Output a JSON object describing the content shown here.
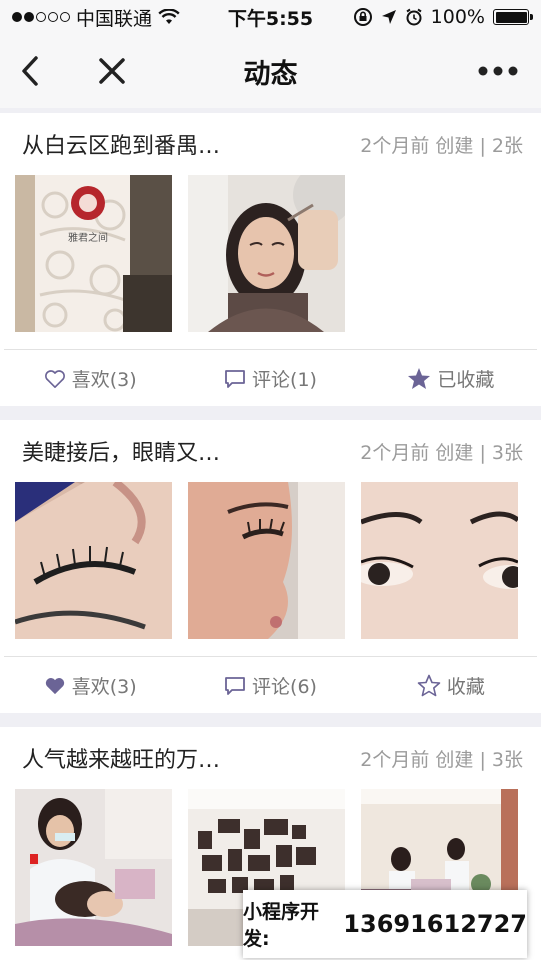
{
  "status_bar": {
    "carrier": "中国联通",
    "time": "下午5:55",
    "battery": "100%"
  },
  "nav": {
    "title": "动态",
    "back_icon": "chevron-left-icon",
    "close_icon": "close-icon",
    "more_icon": "more-dots-icon"
  },
  "colors": {
    "accent": "#6b6496",
    "meta_text": "#9b9b9b",
    "action_text": "#777777"
  },
  "posts": [
    {
      "title": "从白云区跑到番禺…",
      "meta": "2个月前 创建 | 2张",
      "photos": [
        "salon-entrance-photo",
        "brow-treatment-photo"
      ],
      "like_label": "喜欢(3)",
      "like_active": false,
      "comment_label": "评论(1)",
      "favorite_label": "已收藏",
      "favorite_active": true
    },
    {
      "title": "美睫接后，眼睛又…",
      "meta": "2个月前 创建 | 3张",
      "photos": [
        "lash-closeup-photo",
        "lash-profile-photo",
        "eyes-closeup-photo"
      ],
      "like_label": "喜欢(3)",
      "like_active": true,
      "comment_label": "评论(6)",
      "favorite_label": "收藏",
      "favorite_active": false
    },
    {
      "title": "人气越来越旺的万…",
      "meta": "2个月前 创建 | 3张",
      "photos": [
        "technician-working-photo",
        "salon-wall-photo",
        "salon-room-photo"
      ]
    }
  ],
  "watermark": {
    "label": "小程序开发:",
    "phone": "13691612727"
  }
}
